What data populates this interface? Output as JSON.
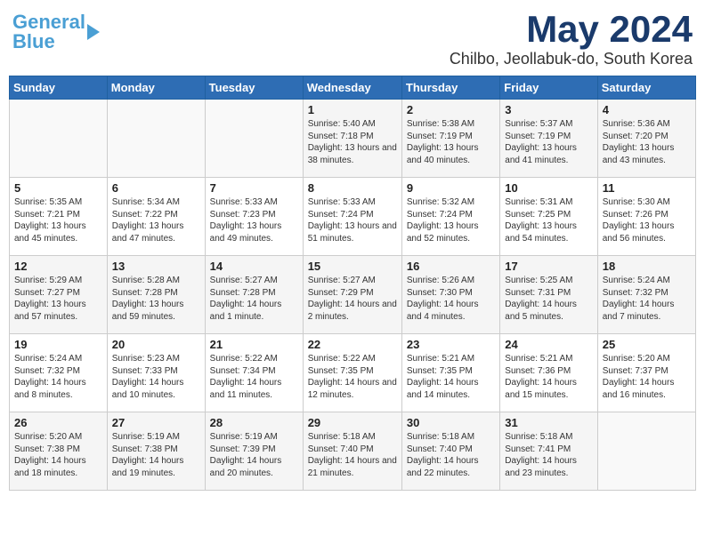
{
  "header": {
    "logo_general": "General",
    "logo_blue": "Blue",
    "month": "May 2024",
    "location": "Chilbo, Jeollabuk-do, South Korea"
  },
  "days_of_week": [
    "Sunday",
    "Monday",
    "Tuesday",
    "Wednesday",
    "Thursday",
    "Friday",
    "Saturday"
  ],
  "weeks": [
    [
      {
        "day": "",
        "sunrise": "",
        "sunset": "",
        "daylight": ""
      },
      {
        "day": "",
        "sunrise": "",
        "sunset": "",
        "daylight": ""
      },
      {
        "day": "",
        "sunrise": "",
        "sunset": "",
        "daylight": ""
      },
      {
        "day": "1",
        "sunrise": "Sunrise: 5:40 AM",
        "sunset": "Sunset: 7:18 PM",
        "daylight": "Daylight: 13 hours and 38 minutes."
      },
      {
        "day": "2",
        "sunrise": "Sunrise: 5:38 AM",
        "sunset": "Sunset: 7:19 PM",
        "daylight": "Daylight: 13 hours and 40 minutes."
      },
      {
        "day": "3",
        "sunrise": "Sunrise: 5:37 AM",
        "sunset": "Sunset: 7:19 PM",
        "daylight": "Daylight: 13 hours and 41 minutes."
      },
      {
        "day": "4",
        "sunrise": "Sunrise: 5:36 AM",
        "sunset": "Sunset: 7:20 PM",
        "daylight": "Daylight: 13 hours and 43 minutes."
      }
    ],
    [
      {
        "day": "5",
        "sunrise": "Sunrise: 5:35 AM",
        "sunset": "Sunset: 7:21 PM",
        "daylight": "Daylight: 13 hours and 45 minutes."
      },
      {
        "day": "6",
        "sunrise": "Sunrise: 5:34 AM",
        "sunset": "Sunset: 7:22 PM",
        "daylight": "Daylight: 13 hours and 47 minutes."
      },
      {
        "day": "7",
        "sunrise": "Sunrise: 5:33 AM",
        "sunset": "Sunset: 7:23 PM",
        "daylight": "Daylight: 13 hours and 49 minutes."
      },
      {
        "day": "8",
        "sunrise": "Sunrise: 5:33 AM",
        "sunset": "Sunset: 7:24 PM",
        "daylight": "Daylight: 13 hours and 51 minutes."
      },
      {
        "day": "9",
        "sunrise": "Sunrise: 5:32 AM",
        "sunset": "Sunset: 7:24 PM",
        "daylight": "Daylight: 13 hours and 52 minutes."
      },
      {
        "day": "10",
        "sunrise": "Sunrise: 5:31 AM",
        "sunset": "Sunset: 7:25 PM",
        "daylight": "Daylight: 13 hours and 54 minutes."
      },
      {
        "day": "11",
        "sunrise": "Sunrise: 5:30 AM",
        "sunset": "Sunset: 7:26 PM",
        "daylight": "Daylight: 13 hours and 56 minutes."
      }
    ],
    [
      {
        "day": "12",
        "sunrise": "Sunrise: 5:29 AM",
        "sunset": "Sunset: 7:27 PM",
        "daylight": "Daylight: 13 hours and 57 minutes."
      },
      {
        "day": "13",
        "sunrise": "Sunrise: 5:28 AM",
        "sunset": "Sunset: 7:28 PM",
        "daylight": "Daylight: 13 hours and 59 minutes."
      },
      {
        "day": "14",
        "sunrise": "Sunrise: 5:27 AM",
        "sunset": "Sunset: 7:28 PM",
        "daylight": "Daylight: 14 hours and 1 minute."
      },
      {
        "day": "15",
        "sunrise": "Sunrise: 5:27 AM",
        "sunset": "Sunset: 7:29 PM",
        "daylight": "Daylight: 14 hours and 2 minutes."
      },
      {
        "day": "16",
        "sunrise": "Sunrise: 5:26 AM",
        "sunset": "Sunset: 7:30 PM",
        "daylight": "Daylight: 14 hours and 4 minutes."
      },
      {
        "day": "17",
        "sunrise": "Sunrise: 5:25 AM",
        "sunset": "Sunset: 7:31 PM",
        "daylight": "Daylight: 14 hours and 5 minutes."
      },
      {
        "day": "18",
        "sunrise": "Sunrise: 5:24 AM",
        "sunset": "Sunset: 7:32 PM",
        "daylight": "Daylight: 14 hours and 7 minutes."
      }
    ],
    [
      {
        "day": "19",
        "sunrise": "Sunrise: 5:24 AM",
        "sunset": "Sunset: 7:32 PM",
        "daylight": "Daylight: 14 hours and 8 minutes."
      },
      {
        "day": "20",
        "sunrise": "Sunrise: 5:23 AM",
        "sunset": "Sunset: 7:33 PM",
        "daylight": "Daylight: 14 hours and 10 minutes."
      },
      {
        "day": "21",
        "sunrise": "Sunrise: 5:22 AM",
        "sunset": "Sunset: 7:34 PM",
        "daylight": "Daylight: 14 hours and 11 minutes."
      },
      {
        "day": "22",
        "sunrise": "Sunrise: 5:22 AM",
        "sunset": "Sunset: 7:35 PM",
        "daylight": "Daylight: 14 hours and 12 minutes."
      },
      {
        "day": "23",
        "sunrise": "Sunrise: 5:21 AM",
        "sunset": "Sunset: 7:35 PM",
        "daylight": "Daylight: 14 hours and 14 minutes."
      },
      {
        "day": "24",
        "sunrise": "Sunrise: 5:21 AM",
        "sunset": "Sunset: 7:36 PM",
        "daylight": "Daylight: 14 hours and 15 minutes."
      },
      {
        "day": "25",
        "sunrise": "Sunrise: 5:20 AM",
        "sunset": "Sunset: 7:37 PM",
        "daylight": "Daylight: 14 hours and 16 minutes."
      }
    ],
    [
      {
        "day": "26",
        "sunrise": "Sunrise: 5:20 AM",
        "sunset": "Sunset: 7:38 PM",
        "daylight": "Daylight: 14 hours and 18 minutes."
      },
      {
        "day": "27",
        "sunrise": "Sunrise: 5:19 AM",
        "sunset": "Sunset: 7:38 PM",
        "daylight": "Daylight: 14 hours and 19 minutes."
      },
      {
        "day": "28",
        "sunrise": "Sunrise: 5:19 AM",
        "sunset": "Sunset: 7:39 PM",
        "daylight": "Daylight: 14 hours and 20 minutes."
      },
      {
        "day": "29",
        "sunrise": "Sunrise: 5:18 AM",
        "sunset": "Sunset: 7:40 PM",
        "daylight": "Daylight: 14 hours and 21 minutes."
      },
      {
        "day": "30",
        "sunrise": "Sunrise: 5:18 AM",
        "sunset": "Sunset: 7:40 PM",
        "daylight": "Daylight: 14 hours and 22 minutes."
      },
      {
        "day": "31",
        "sunrise": "Sunrise: 5:18 AM",
        "sunset": "Sunset: 7:41 PM",
        "daylight": "Daylight: 14 hours and 23 minutes."
      },
      {
        "day": "",
        "sunrise": "",
        "sunset": "",
        "daylight": ""
      }
    ]
  ]
}
